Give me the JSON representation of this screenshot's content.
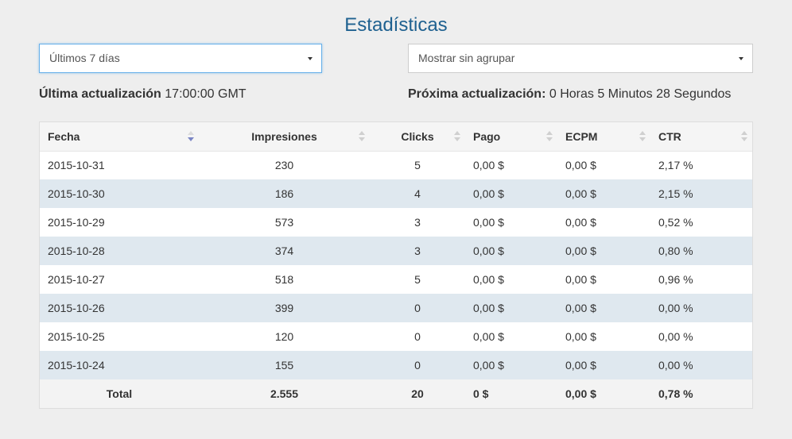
{
  "page": {
    "title": "Estadísticas"
  },
  "filters": {
    "period": {
      "value": "Últimos 7 días"
    },
    "grouping": {
      "value": "Mostrar sin agrupar"
    }
  },
  "status": {
    "last_update_label": "Última actualización",
    "last_update_value": "17:00:00 GMT",
    "next_update_label": "Próxima actualización:",
    "next_update_value": "0 Horas 5 Minutos 28 Segundos"
  },
  "table": {
    "headers": [
      "Fecha",
      "Impresiones",
      "Clicks",
      "Pago",
      "ECPM",
      "CTR"
    ],
    "rows": [
      [
        "2015-10-31",
        "230",
        "5",
        "0,00 $",
        "0,00 $",
        "2,17 %"
      ],
      [
        "2015-10-30",
        "186",
        "4",
        "0,00 $",
        "0,00 $",
        "2,15 %"
      ],
      [
        "2015-10-29",
        "573",
        "3",
        "0,00 $",
        "0,00 $",
        "0,52 %"
      ],
      [
        "2015-10-28",
        "374",
        "3",
        "0,00 $",
        "0,00 $",
        "0,80 %"
      ],
      [
        "2015-10-27",
        "518",
        "5",
        "0,00 $",
        "0,00 $",
        "0,96 %"
      ],
      [
        "2015-10-26",
        "399",
        "0",
        "0,00 $",
        "0,00 $",
        "0,00 %"
      ],
      [
        "2015-10-25",
        "120",
        "0",
        "0,00 $",
        "0,00 $",
        "0,00 %"
      ],
      [
        "2015-10-24",
        "155",
        "0",
        "0,00 $",
        "0,00 $",
        "0,00 %"
      ]
    ],
    "totals": [
      "Total",
      "2.555",
      "20",
      "0 $",
      "0,00 $",
      "0,78 %"
    ]
  }
}
